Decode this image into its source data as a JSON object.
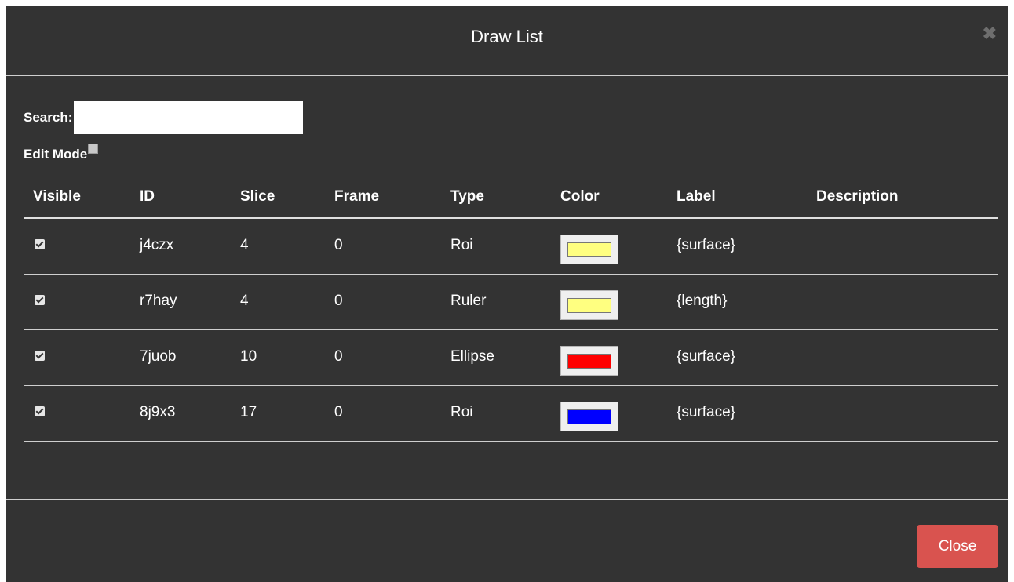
{
  "dialog": {
    "title": "Draw List",
    "close_icon": "close-icon"
  },
  "search": {
    "label": "Search:",
    "value": "",
    "placeholder": ""
  },
  "edit_mode": {
    "label": "Edit Mode",
    "checked": false
  },
  "table": {
    "headers": [
      "Visible",
      "ID",
      "Slice",
      "Frame",
      "Type",
      "Color",
      "Label",
      "Description"
    ],
    "rows": [
      {
        "visible": true,
        "id": "j4czx",
        "slice": "4",
        "frame": "0",
        "type": "Roi",
        "color": "#ffff80",
        "label": "{surface}",
        "description": ""
      },
      {
        "visible": true,
        "id": "r7hay",
        "slice": "4",
        "frame": "0",
        "type": "Ruler",
        "color": "#ffff80",
        "label": "{length}",
        "description": ""
      },
      {
        "visible": true,
        "id": "7juob",
        "slice": "10",
        "frame": "0",
        "type": "Ellipse",
        "color": "#ff0000",
        "label": "{surface}",
        "description": ""
      },
      {
        "visible": true,
        "id": "8j9x3",
        "slice": "17",
        "frame": "0",
        "type": "Roi",
        "color": "#0000ff",
        "label": "{surface}",
        "description": ""
      }
    ]
  },
  "footer": {
    "close_label": "Close"
  },
  "colors": {
    "background": "#333333",
    "close_button": "#d9534f"
  }
}
